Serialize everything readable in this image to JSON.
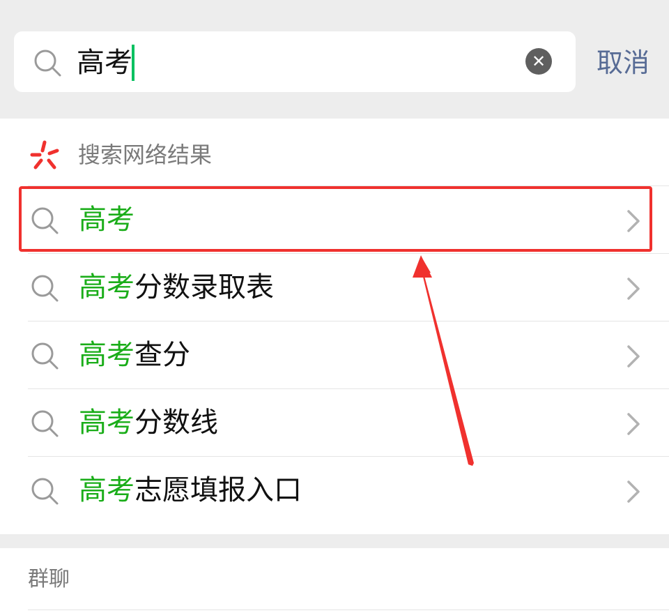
{
  "search": {
    "query": "高考",
    "cancel_label": "取消",
    "clear_icon": "close-circle-icon"
  },
  "web_results": {
    "section_title": "搜索网络结果",
    "logo_icon": "web-search-logo-icon",
    "items": [
      {
        "highlight": "高考",
        "rest": ""
      },
      {
        "highlight": "高考",
        "rest": "分数录取表"
      },
      {
        "highlight": "高考",
        "rest": "查分"
      },
      {
        "highlight": "高考",
        "rest": "分数线"
      },
      {
        "highlight": "高考",
        "rest": "志愿填报入口"
      }
    ]
  },
  "group_chats": {
    "section_title": "群聊"
  },
  "colors": {
    "accent_green": "#1aad19",
    "cancel_blue": "#576b95",
    "annotation_red": "#f0312e"
  }
}
